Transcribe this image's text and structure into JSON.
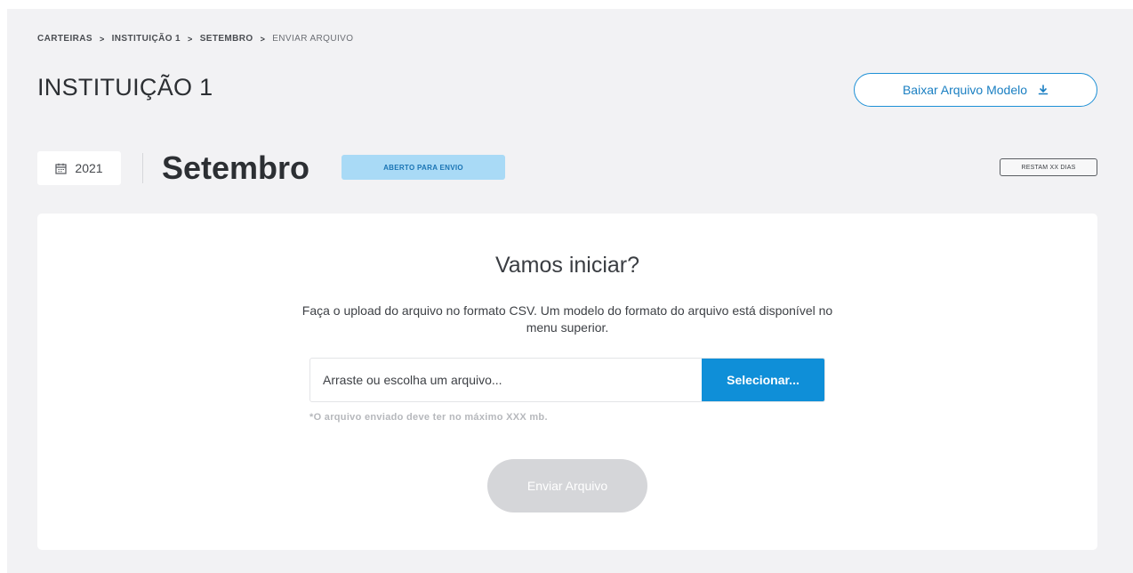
{
  "breadcrumb": {
    "items": [
      "CARTEIRAS",
      "INSTITUIÇÃO 1",
      "SETEMBRO"
    ],
    "current": "ENVIAR ARQUIVO",
    "separator": ">"
  },
  "header": {
    "title": "INSTITUIÇÃO 1",
    "download_label": "Baixar Arquivo Modelo",
    "download_icon": "download-icon"
  },
  "period": {
    "year": "2021",
    "year_icon": "calendar-icon",
    "month": "Setembro",
    "status": "ABERTO PARA ENVIO",
    "days_left": "RESTAM XX DIAS"
  },
  "upload": {
    "title": "Vamos iniciar?",
    "description": "Faça o upload do arquivo no formato CSV. Um modelo do formato do arquivo está disponível no menu superior.",
    "input_placeholder": "Arraste ou escolha um arquivo...",
    "select_label": "Selecionar...",
    "hint": "*O arquivo enviado deve ter no máximo XXX mb.",
    "send_label": "Enviar Arquivo"
  },
  "colors": {
    "accent": "#0f8fd8",
    "badge_bg": "#a9daf6",
    "background": "#f2f2f4",
    "disabled": "#d5d6d9"
  }
}
